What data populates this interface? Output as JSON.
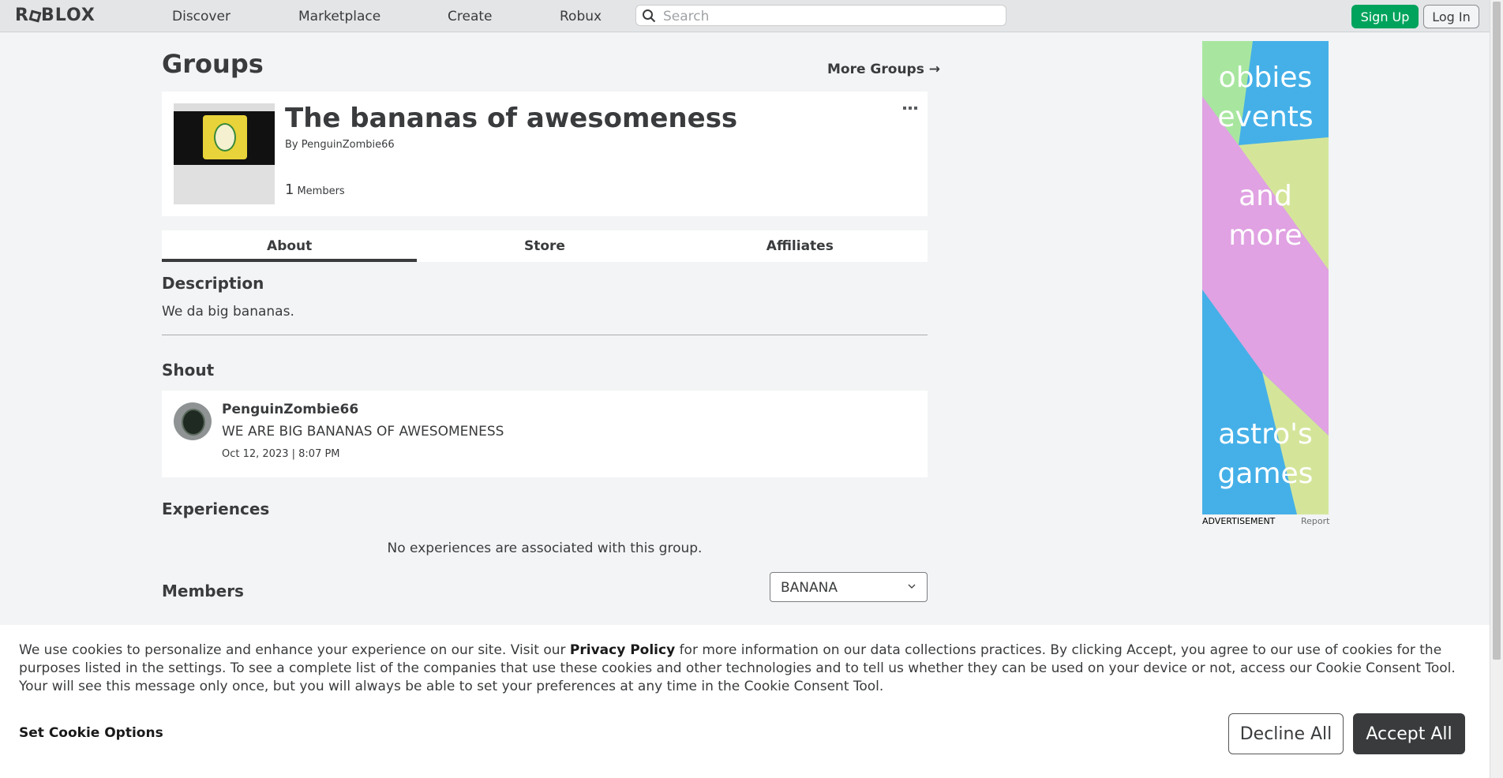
{
  "header": {
    "logo": "ROBLOX",
    "nav": [
      "Discover",
      "Marketplace",
      "Create",
      "Robux"
    ],
    "search_placeholder": "Search",
    "signup_label": "Sign Up",
    "login_label": "Log In"
  },
  "page": {
    "title": "Groups",
    "more_groups": "More Groups",
    "group": {
      "name": "The bananas of awesomeness",
      "by_prefix": "By",
      "owner": "PenguinZombie66",
      "member_count": "1",
      "members_label": "Members"
    },
    "tabs": [
      "About",
      "Store",
      "Affiliates"
    ],
    "active_tab": "About",
    "description_heading": "Description",
    "description": "We da big bananas.",
    "shout_heading": "Shout",
    "shout": {
      "user": "PenguinZombie66",
      "message": "WE ARE BIG BANANAS OF AWESOMENESS",
      "date": "Oct 12, 2023 | 8:07 PM"
    },
    "experiences_heading": "Experiences",
    "no_experiences": "No experiences are associated with this group.",
    "members_heading": "Members",
    "role_selected": "BANANA"
  },
  "ad": {
    "words": [
      "obbies",
      "events",
      "and",
      "more",
      "astro's",
      "games"
    ],
    "label": "ADVERTISEMENT",
    "report": "Report",
    "colors": {
      "green": "#a8e6a0",
      "blue": "#45b0e8",
      "pink": "#e0a2e2",
      "lime": "#d4e59a"
    }
  },
  "cookie": {
    "text_before": "We use cookies to personalize and enhance your experience on our site. Visit our ",
    "privacy_link": "Privacy Policy",
    "text_after": " for more information on our data collections practices. By clicking Accept, you agree to our use of cookies for the purposes listed in the settings. To see a complete list of the companies that use these cookies and other technologies and to tell us whether they can be used on your device or not, access our Cookie Consent Tool. Your will see this message only once, but you will always be able to set your preferences at any time in the Cookie Consent Tool.",
    "set_options": "Set Cookie Options",
    "decline": "Decline All",
    "accept": "Accept All"
  },
  "colors": {
    "signup_green": "#00a35c",
    "text_dark": "#393b3d",
    "page_bg": "#f2f4f5"
  }
}
